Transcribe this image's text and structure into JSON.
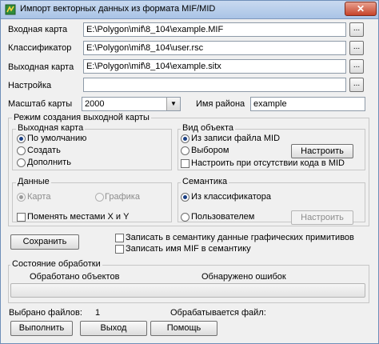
{
  "window": {
    "title": "Импорт векторных данных из формата MIF/MID",
    "close_label": "✕"
  },
  "inputs": {
    "input_map_label": "Входная карта",
    "input_map_value": "E:\\Polygon\\mif\\8_104\\example.MIF",
    "classifier_label": "Классификатор",
    "classifier_value": "E:\\Polygon\\mif\\8_104\\user.rsc",
    "output_map_label": "Выходная карта",
    "output_map_value": "E:\\Polygon\\mif\\8_104\\example.sitx",
    "settings_label": "Настройка",
    "settings_value": "",
    "browse_label": "..."
  },
  "scale": {
    "label": "Масштаб карты",
    "value": "2000",
    "region_label": "Имя района",
    "region_value": "example"
  },
  "mode": {
    "title": "Режим  создания выходной карты",
    "output_map": {
      "title": "Выходная карта",
      "default_label": "По умолчанию",
      "create_label": "Создать",
      "append_label": "Дополнить",
      "selected": "default"
    },
    "object_type": {
      "title": "Вид объекта",
      "from_mid_label": "Из записи файла MID",
      "by_choice_label": "Выбором",
      "setup_button": "Настроить",
      "setup_missing_label": "Настроить при отсутствии кода в MID",
      "selected": "from_mid"
    },
    "data": {
      "title": "Данные",
      "map_label": "Карта",
      "graphics_label": "Графика",
      "swap_label": "Поменять местами  X и Y",
      "selected": "map"
    },
    "semantics": {
      "title": "Семантика",
      "from_classifier_label": "Из классификатора",
      "by_user_label": "Пользователем",
      "setup_button": "Настроить",
      "selected": "from_classifier"
    }
  },
  "actions": {
    "save_label": "Сохранить",
    "write_graphic_label": "Записать в семантику данные графических примитивов",
    "write_mif_name_label": "Записать имя MIF в семантику"
  },
  "status": {
    "title": "Состояние обработки",
    "processed_label": "Обработано объектов",
    "errors_label": "Обнаружено ошибок",
    "progress_percent": 0,
    "files_selected_label": "Выбрано файлов:",
    "files_selected_value": "1",
    "processing_label": "Обрабатывается файл:",
    "processing_value": ""
  },
  "buttons": {
    "run_label": "Выполнить",
    "exit_label": "Выход",
    "help_label": "Помощь"
  },
  "colors": {
    "title_bar": "#a9c3e6",
    "close_button": "#c7432a"
  }
}
